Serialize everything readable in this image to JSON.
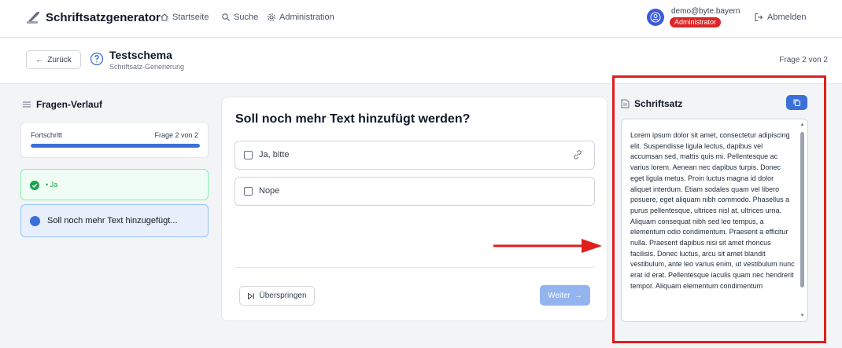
{
  "header": {
    "app_title": "Schriftsatzgenerator",
    "nav": [
      {
        "label": "Startseite",
        "icon": "home-icon"
      },
      {
        "label": "Suche",
        "icon": "search-icon"
      },
      {
        "label": "Administration",
        "icon": "gear-icon"
      }
    ],
    "user": {
      "email": "demo@byte.bayern",
      "role": "Administrator"
    },
    "logout_label": "Abmelden"
  },
  "subheader": {
    "back_label": "Zurück",
    "title": "Testschema",
    "subtitle": "Schriftsatz-Generierung",
    "page_indicator": "Frage 2 von 2"
  },
  "history": {
    "title": "Fragen-Verlauf",
    "progress": {
      "label": "Fortschritt",
      "value": "Frage 2 von 2",
      "fraction": 1.0
    },
    "items": [
      {
        "label": "• Ja",
        "status": "answered"
      },
      {
        "label": "Soll noch mehr Text hinzugefügt...",
        "status": "current"
      }
    ]
  },
  "question": {
    "title": "Soll noch mehr Text hinzufügt werden?",
    "options": [
      {
        "label": "Ja, bitte"
      },
      {
        "label": "Nope"
      }
    ],
    "skip_label": "Überspringen",
    "next_label": "Weiter"
  },
  "schriftsatz": {
    "title": "Schriftsatz",
    "text": "Lorem ipsum dolor sit amet, consectetur adipiscing elit. Suspendisse ligula lectus, dapibus vel accumsan sed, mattis quis mi. Pellentesque ac varius lorem. Aenean nec dapibus turpis. Donec eget ligula metus. Proin luctus magna id dolor aliquet interdum. Etiam sodales quam vel libero posuere, eget aliquam nibh commodo. Phasellus a purus pellentesque, ultrices nisl at, ultrices urna. Aliquam consequat nibh sed leo tempus, a elementum odio condimentum. Praesent a efficitur nulla. Praesent dapibus nisi sit amet rhoncus facilisis. Donec luctus, arcu sit amet blandit vestibulum, ante leo varius enim, ut vestibulum nunc erat id erat. Pellentesque iaculis quam nec hendrerit tempor. Aliquam elementum condimentum"
  },
  "colors": {
    "accent": "#3b6fd9",
    "success": "#16a34a",
    "danger": "#dc2626",
    "annotation": "#e01e1e"
  }
}
